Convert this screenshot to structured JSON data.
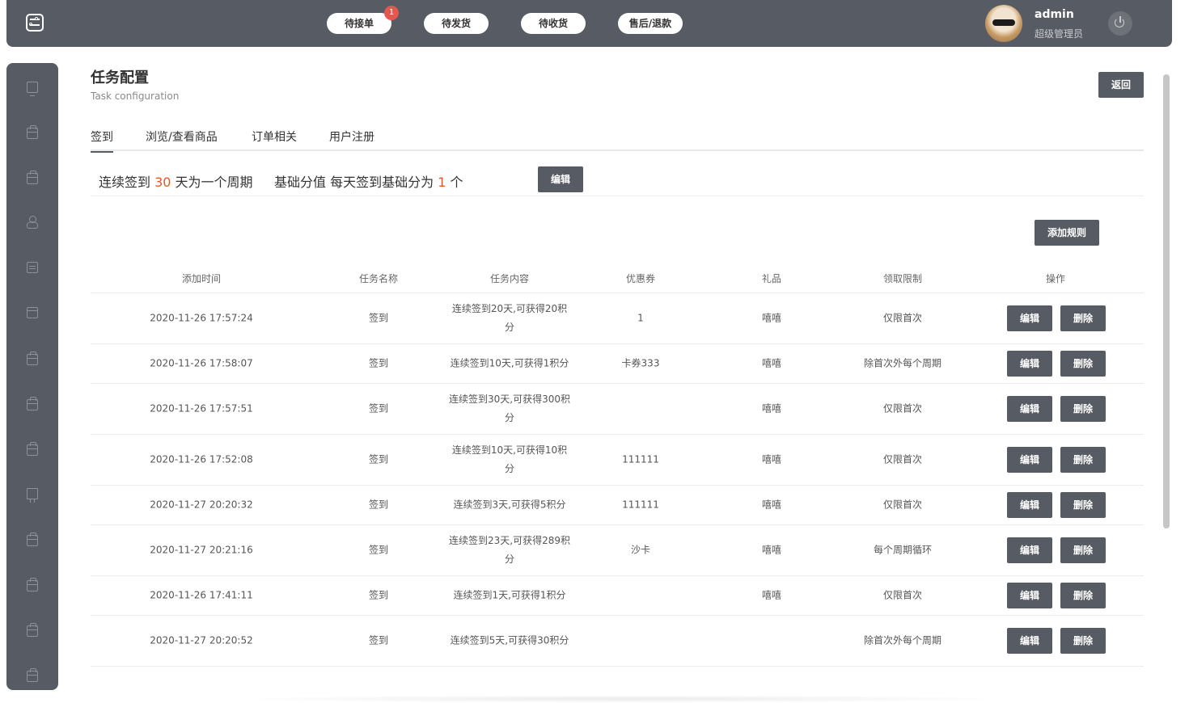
{
  "header": {
    "buttons": [
      {
        "label": "待接单",
        "badge": "1"
      },
      {
        "label": "待发货"
      },
      {
        "label": "待收货"
      },
      {
        "label": "售后/退款"
      }
    ],
    "user": {
      "name": "admin",
      "role": "超级管理员"
    }
  },
  "sidebar": {
    "icons": [
      "monitor-icon",
      "box-icon",
      "box-icon",
      "user-icon",
      "document-icon",
      "store-icon",
      "box-icon",
      "box-icon",
      "box-icon",
      "board-icon",
      "box-icon",
      "box-icon",
      "box-icon",
      "box-icon"
    ]
  },
  "page": {
    "title": "任务配置",
    "subtitle": "Task configuration",
    "back_label": "返回"
  },
  "tabs": [
    "签到",
    "浏览/查看商品",
    "订单相关",
    "用户注册"
  ],
  "rule": {
    "cycle_prefix": "连续签到 ",
    "cycle_days": "30",
    "cycle_suffix": " 天为一个周期",
    "base_prefix": "基础分值 每天签到基础分为 ",
    "base_value": "1",
    "base_suffix": " 个",
    "edit_label": "编辑"
  },
  "add_rule_label": "添加规则",
  "table": {
    "headers": [
      "添加时间",
      "任务名称",
      "任务内容",
      "优惠券",
      "礼品",
      "领取限制",
      "操作"
    ],
    "edit_label": "编辑",
    "delete_label": "删除",
    "rows": [
      {
        "time": "2020-11-26 17:57:24",
        "name": "签到",
        "content": "连续签到20天,可获得20积分",
        "coupon": "1",
        "gift": "嘻嘻",
        "limit": "仅限首次"
      },
      {
        "time": "2020-11-26 17:58:07",
        "name": "签到",
        "content": "连续签到10天,可获得1积分",
        "coupon": "卡券333",
        "gift": "嘻嘻",
        "limit": "除首次外每个周期"
      },
      {
        "time": "2020-11-26 17:57:51",
        "name": "签到",
        "content": "连续签到30天,可获得300积分",
        "coupon": "",
        "gift": "嘻嘻",
        "limit": "仅限首次"
      },
      {
        "time": "2020-11-26 17:52:08",
        "name": "签到",
        "content": "连续签到10天,可获得10积分",
        "coupon": "111111",
        "gift": "嘻嘻",
        "limit": "仅限首次"
      },
      {
        "time": "2020-11-27 20:20:32",
        "name": "签到",
        "content": "连续签到3天,可获得5积分",
        "coupon": "111111",
        "gift": "嘻嘻",
        "limit": "仅限首次"
      },
      {
        "time": "2020-11-27 20:21:16",
        "name": "签到",
        "content": "连续签到23天,可获得289积分",
        "coupon": "沙卡",
        "gift": "嘻嘻",
        "limit": "每个周期循环"
      },
      {
        "time": "2020-11-26 17:41:11",
        "name": "签到",
        "content": "连续签到1天,可获得1积分",
        "coupon": "",
        "gift": "嘻嘻",
        "limit": "仅限首次"
      },
      {
        "time": "2020-11-27 20:20:52",
        "name": "签到",
        "content": "连续签到5天,可获得30积分",
        "coupon": "",
        "gift": "",
        "limit": "除首次外每个周期"
      }
    ]
  }
}
